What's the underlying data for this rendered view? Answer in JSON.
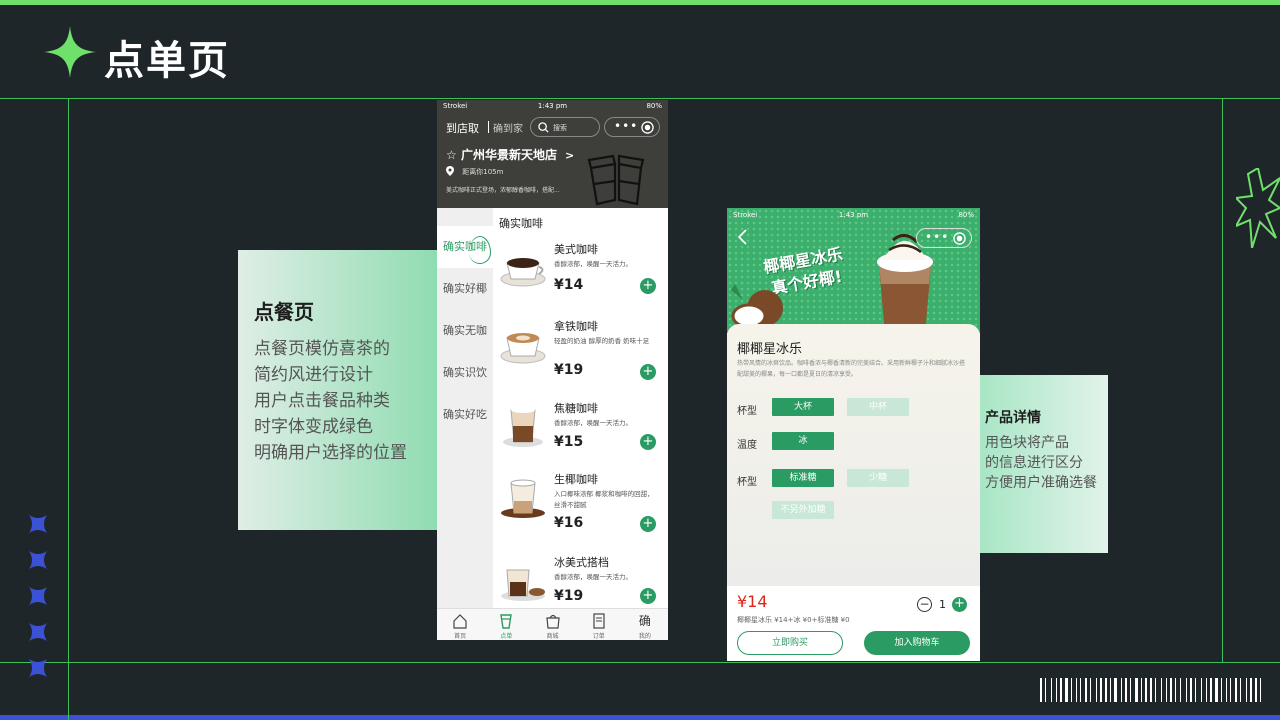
{
  "slide": {
    "title": "点单页",
    "colors": {
      "accent": "#6fe06a",
      "brand_green": "#2b9b64",
      "background": "#1f262a",
      "deco_blue": "#3c52d6"
    }
  },
  "left_card": {
    "heading": "点餐页",
    "lines": [
      "点餐页模仿喜茶的",
      "简约风进行设计",
      "用户点击餐品种类",
      "时字体变成绿色",
      "明确用户选择的位置"
    ]
  },
  "right_card": {
    "heading": "产品详情",
    "lines": [
      "用色块将产品",
      "的信息进行区分",
      "方便用户准确选餐"
    ]
  },
  "phone1": {
    "status": {
      "carrier": "Strokei",
      "time": "1:43 pm",
      "battery": "80%"
    },
    "mode_pickup": "到店取",
    "mode_delivery": "确到家",
    "search_placeholder": "搜索",
    "store_name": "广州华景新天地店",
    "distance": "距离你105m",
    "notice": "美式咖啡正式登场，浓郁醇香咖啡，搭配...",
    "categories": [
      "确实咖啡",
      "确实好椰",
      "确实无咖",
      "确实识饮",
      "确实好吃"
    ],
    "section_title": "确实咖啡",
    "items": [
      {
        "name": "美式咖啡",
        "desc": "香醇浓郁，唤醒一天活力。",
        "price": "¥14"
      },
      {
        "name": "拿铁咖啡",
        "desc": "轻盈的奶油 醇厚的奶香 奶味十足",
        "price": "¥19"
      },
      {
        "name": "焦糖咖啡",
        "desc": "香醇浓郁，唤醒一天活力。",
        "price": "¥15"
      },
      {
        "name": "生椰咖啡",
        "desc": "入口椰味浓郁 椰浆和咖啡的回甜，丝滑不甜腻",
        "price": "¥16"
      },
      {
        "name": "冰美式搭档",
        "desc": "香醇浓郁，唤醒一天活力。",
        "price": "¥19"
      }
    ],
    "tabs": [
      {
        "label": "首页",
        "icon": "home-icon"
      },
      {
        "label": "点单",
        "icon": "cup-icon"
      },
      {
        "label": "商城",
        "icon": "bag-icon"
      },
      {
        "label": "订单",
        "icon": "order-icon"
      },
      {
        "label": "我的",
        "icon": "profile-icon",
        "glyph": "确"
      }
    ]
  },
  "phone2": {
    "status": {
      "carrier": "Strokei",
      "time": "1:43 pm",
      "battery": "80%"
    },
    "banner_line1": "椰椰星冰乐",
    "banner_line2": "真个好椰!",
    "product_name": "椰椰星冰乐",
    "product_desc": "热带风情的冰爽饮品。咖啡香浓与椰香清新的完美结合。采用新鲜椰子汁和细腻冰沙搭配甜美的椰果，每一口都是夏日的清凉享受。",
    "option_groups": [
      {
        "label": "杯型",
        "options": [
          {
            "text": "大杯",
            "selected": true
          },
          {
            "text": "中杯",
            "selected": false
          }
        ]
      },
      {
        "label": "温度",
        "options": [
          {
            "text": "冰",
            "selected": true
          }
        ]
      },
      {
        "label": "杯型",
        "options": [
          {
            "text": "标准糖",
            "selected": true
          },
          {
            "text": "少糖",
            "selected": false
          },
          {
            "text": "不另外加糖",
            "selected": false
          }
        ]
      }
    ],
    "price": "¥14",
    "selection_summary": "椰椰星冰乐 ¥14+冰 ¥0+标准糖 ¥0",
    "quantity": "1",
    "buy_now": "立即购买",
    "add_to_cart": "加入购物车"
  }
}
